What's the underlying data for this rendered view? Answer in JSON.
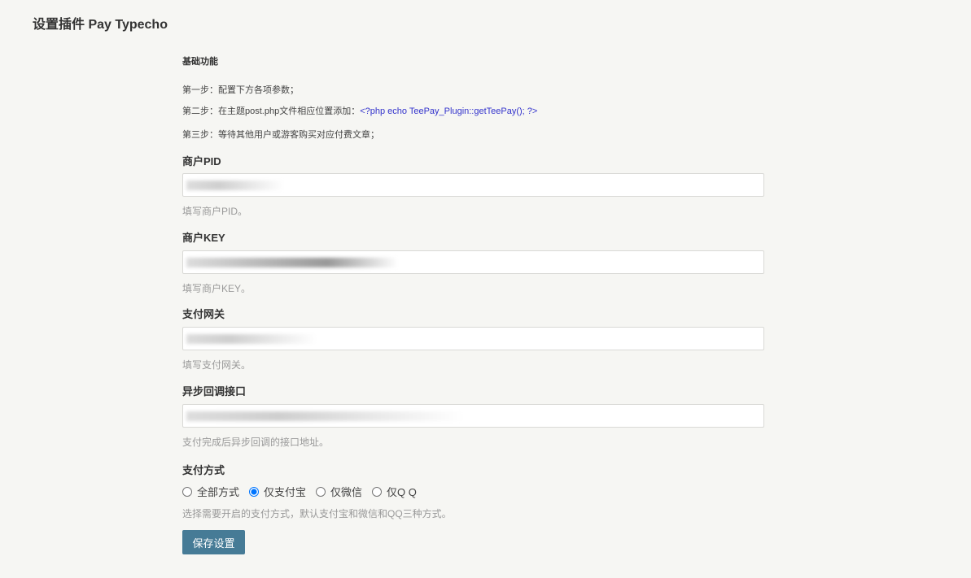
{
  "title": "设置插件 Pay Typecho",
  "section": "基础功能",
  "steps": {
    "s1": "第一步：配置下方各项参数；",
    "s2": "第二步：在主题post.php文件相应位置添加：",
    "s2_code": "<?php echo TeePay_Plugin::getTeePay(); ?>",
    "s3": "第三步：等待其他用户或游客购买对应付费文章；"
  },
  "fields": [
    {
      "label": "商户PID",
      "desc": "填写商户PID。"
    },
    {
      "label": "商户KEY",
      "desc": "填写商户KEY。"
    },
    {
      "label": "支付网关",
      "desc": "填写支付网关。"
    },
    {
      "label": "异步回调接口",
      "desc": "支付完成后异步回调的接口地址。"
    }
  ],
  "payment": {
    "label": "支付方式",
    "options": [
      "全部方式",
      "仅支付宝",
      "仅微信",
      "仅Q Q"
    ],
    "selected": "仅支付宝",
    "desc": "选择需要开启的支付方式，默认支付宝和微信和QQ三种方式。"
  },
  "save": "保存设置",
  "accent": "#467b96"
}
